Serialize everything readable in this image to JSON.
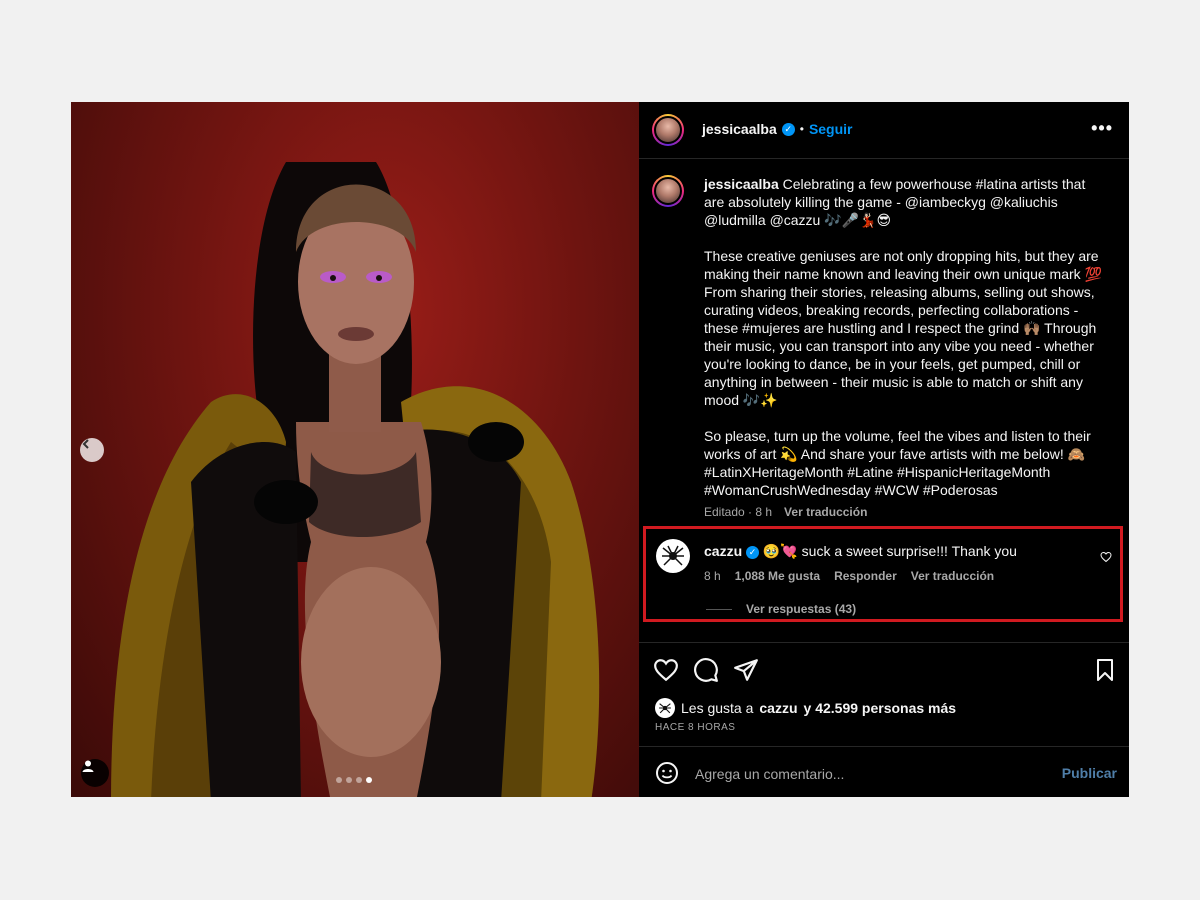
{
  "colors": {
    "page_bg": "#f1f1f1",
    "panel_bg": "#000000",
    "accent_blue": "#0095f6",
    "highlight_red": "#d11a20",
    "muted_text": "#a8a8a8"
  },
  "carousel": {
    "slide_count": 4,
    "active_slide": 4,
    "prev_icon": "chevron-left-icon",
    "tag_icon": "user-tag-icon"
  },
  "header": {
    "username": "jessicaalba",
    "separator": "•",
    "follow_label": "Seguir",
    "more_icon": "more-icon",
    "more_label": "•••"
  },
  "caption": {
    "username": "jessicaalba",
    "text": "Celebrating a few powerhouse #latina artists that are absolutely killing the game - @iambeckyg @kaliuchis @ludmilla @cazzu 🎶🎤💃🏻😎\n\nThese creative geniuses are not only dropping hits, but they are making their name known and leaving their own unique mark 💯 From sharing their stories, releasing albums, selling out shows, curating videos, breaking records, perfecting collaborations - these #mujeres are hustling and I respect the grind 🙌🏽 Through their music, you can transport into any vibe you need - whether you're looking to dance, be in your feels, get pumped, chill or anything in between - their music is able to match or shift any mood 🎶✨\n\nSo please, turn up the volume, feel the vibes and listen to their works of art 💫 And share your fave artists with me below! 🙈\n#LatinXHeritageMonth #Latine #HispanicHeritageMonth #WomanCrushWednesday #WCW #Poderosas",
    "edited": "Editado · 8 h",
    "translate": "Ver traducción"
  },
  "comment": {
    "username": "cazzu",
    "text": "🥹💘 suck a sweet surprise!!! Thank you",
    "time": "8 h",
    "likes": "1,088 Me gusta",
    "reply": "Responder",
    "translate": "Ver traducción",
    "view_replies": "Ver respuestas (43)",
    "like_icon": "heart-outline-icon"
  },
  "actions": {
    "like_icon": "heart-icon",
    "comment_icon": "comment-icon",
    "share_icon": "send-icon",
    "save_icon": "bookmark-icon"
  },
  "likes": {
    "prefix": "Les gusta a",
    "user": "cazzu",
    "suffix": "y 42.599 personas más",
    "time_ago": "HACE 8 HORAS"
  },
  "composer": {
    "placeholder": "Agrega un comentario...",
    "publish_label": "Publicar",
    "emoji_icon": "emoji-icon"
  }
}
